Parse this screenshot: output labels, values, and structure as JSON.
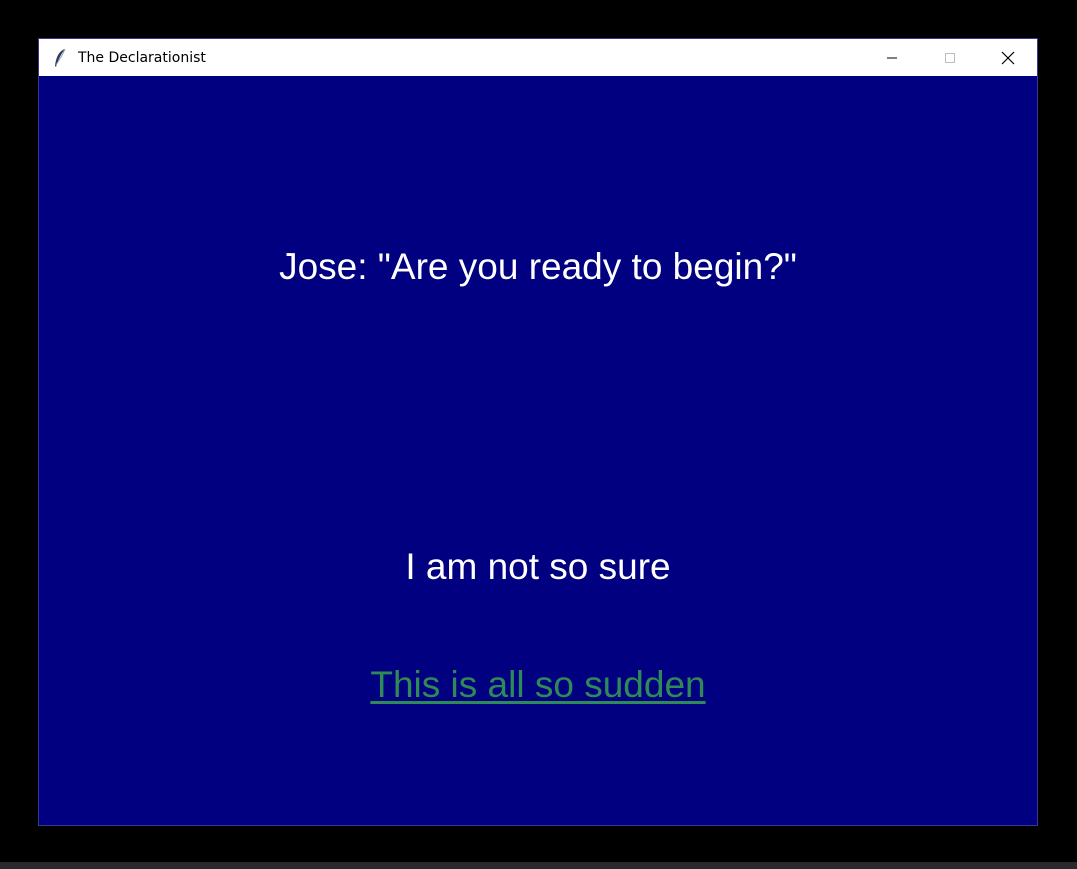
{
  "window": {
    "title": "The Declarationist",
    "background_color": "#000080",
    "icon": "feather-icon",
    "controls": [
      "minimize-icon",
      "maximize-icon",
      "close-icon"
    ]
  },
  "dialogue": {
    "speaker_line": "Jose: \"Are you ready to begin?\"",
    "color": "#ffffff"
  },
  "choices": [
    {
      "label": "I am not so sure",
      "color": "#ffffff",
      "state": "normal"
    },
    {
      "label": "This is all so sudden",
      "color": "#2e8b57",
      "state": "hovered/underlined"
    }
  ]
}
